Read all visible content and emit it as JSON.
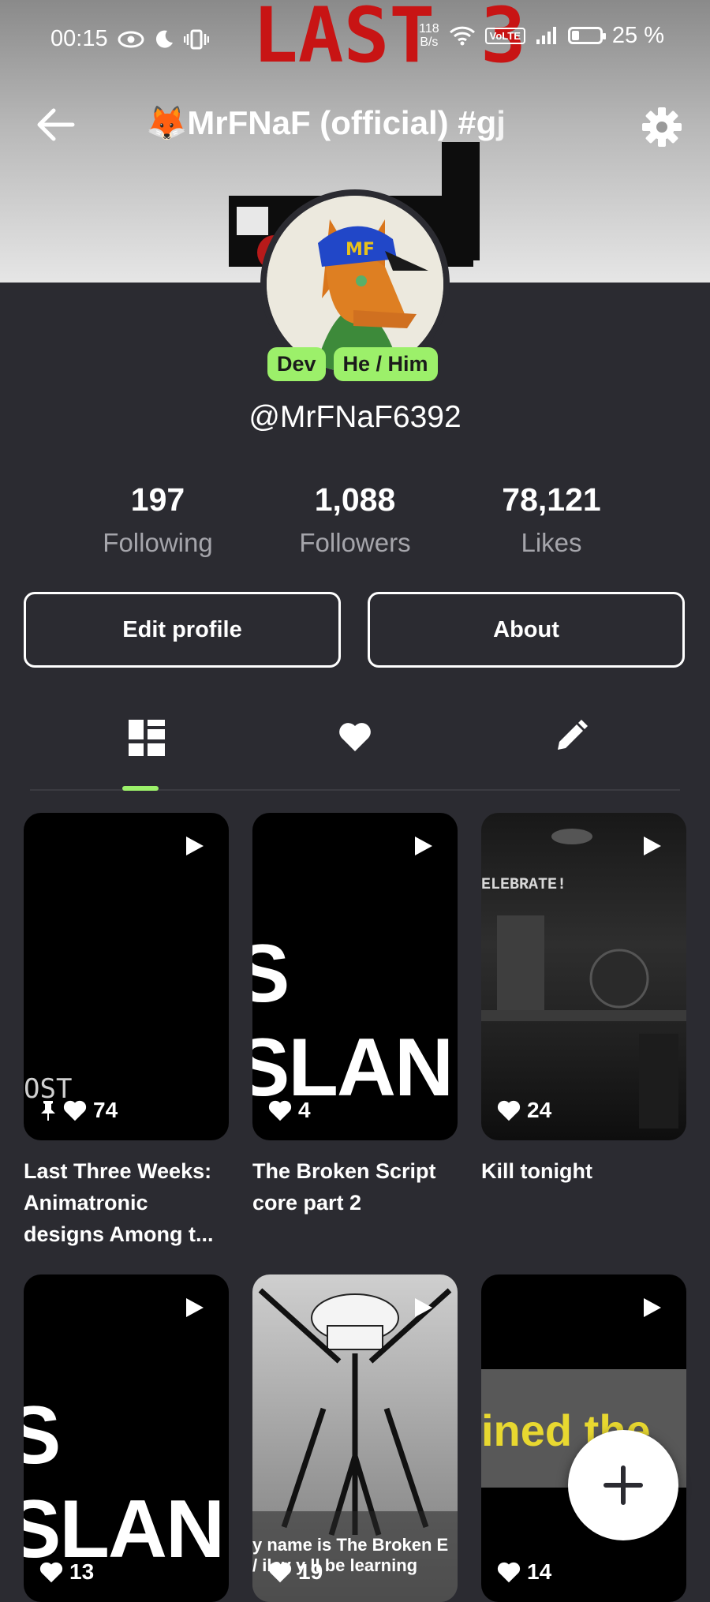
{
  "status_bar": {
    "time": "00:15",
    "net_speed_value": "118",
    "net_speed_unit": "B/s",
    "volte": "VoLTE",
    "battery_percent": "25 %",
    "battery_level": 0.25
  },
  "banner": {
    "art_text": "LAST 3"
  },
  "header": {
    "title": "🦊MrFNaF (official) #gj"
  },
  "profile": {
    "badges": [
      "Dev",
      "He / Him"
    ],
    "handle": "@MrFNaF6392",
    "avatar_cap_text": "MF"
  },
  "stats": [
    {
      "value": "197",
      "label": "Following"
    },
    {
      "value": "1,088",
      "label": "Followers"
    },
    {
      "value": "78,121",
      "label": "Likes"
    }
  ],
  "buttons": {
    "edit_profile": "Edit profile",
    "about": "About"
  },
  "posts": [
    {
      "likes": "74",
      "pinned": true,
      "thumb_text": "OST",
      "caption": "Last Three Weeks: Animatronic designs Among t..."
    },
    {
      "likes": "4",
      "thumb_text": "S SLANI",
      "caption": "The Broken Script core part 2"
    },
    {
      "likes": "24",
      "thumb_text": "ELEBRATE!",
      "caption": "Kill tonight"
    },
    {
      "likes": "13",
      "thumb_text": "S SLANI",
      "caption": ""
    },
    {
      "likes": "19",
      "thumb_text": "y name is The Broken E / ilay y ll be learning",
      "caption": ""
    },
    {
      "likes": "14",
      "thumb_text": "ined the",
      "caption": ""
    }
  ],
  "colors": {
    "background": "#2b2b31",
    "accent": "#9cf06a",
    "muted_text": "#a5a5ab"
  }
}
